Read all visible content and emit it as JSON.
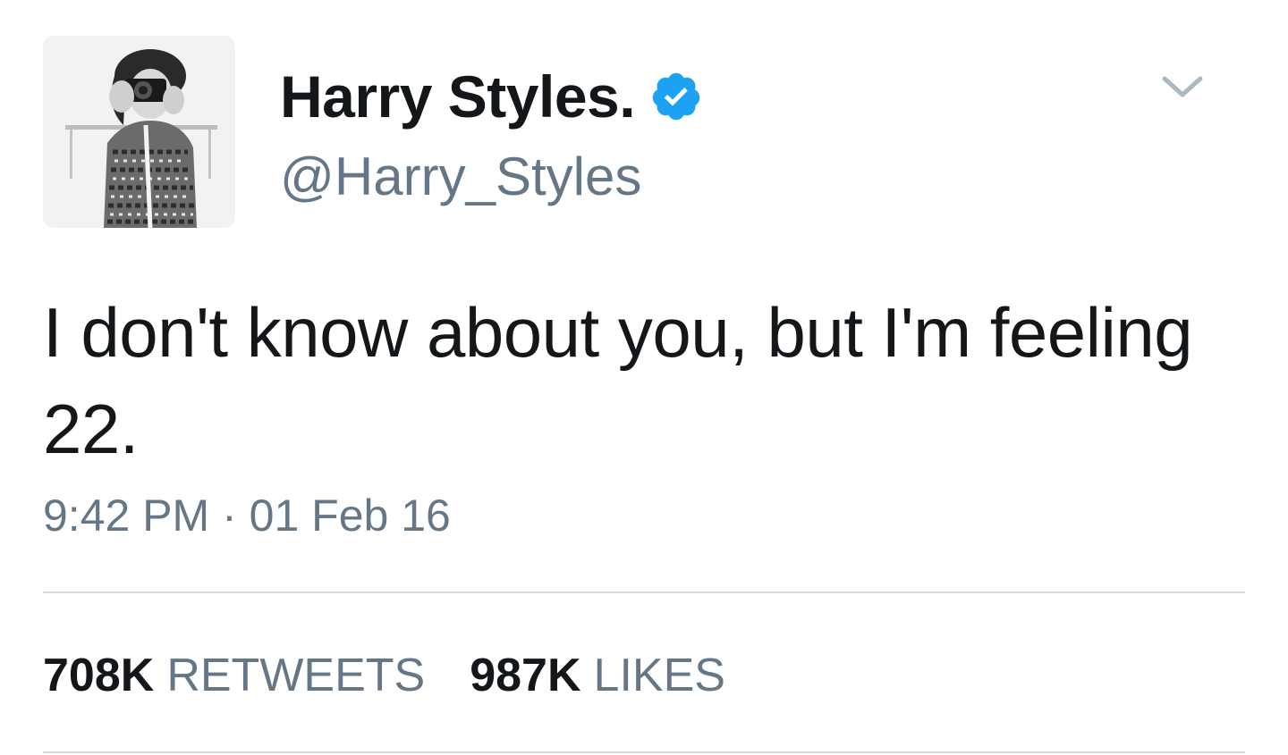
{
  "tweet": {
    "display_name": "Harry Styles.",
    "handle": "@Harry_Styles",
    "text": "I don't know about you, but I'm feeling 22.",
    "timestamp": "9:42 PM · 01 Feb 16",
    "verified": true,
    "avatar_icon": "profile-photo",
    "menu_icon": "chevron-down-icon"
  },
  "stats": {
    "retweets_count": "708K",
    "retweets_label": "RETWEETS",
    "likes_count": "987K",
    "likes_label": "LIKES"
  },
  "colors": {
    "verified_blue": "#1da1f2",
    "text_primary": "#14171a",
    "text_secondary": "#657786",
    "divider": "#d3dbe2",
    "caret": "#aab8c2"
  }
}
